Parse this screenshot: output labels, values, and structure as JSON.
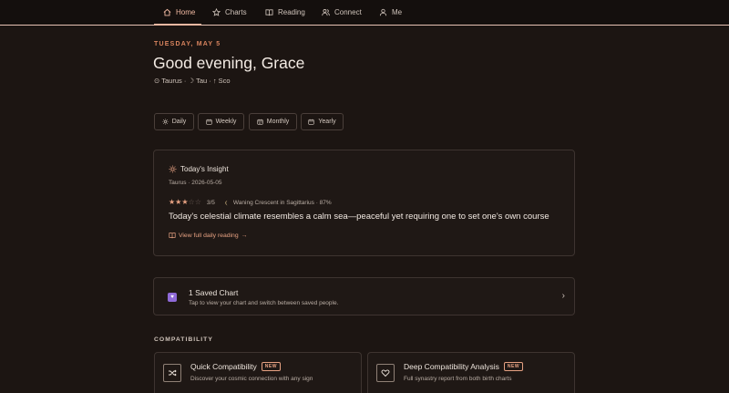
{
  "nav": {
    "items": [
      {
        "label": "Home",
        "icon": "home-icon",
        "active": true
      },
      {
        "label": "Charts",
        "icon": "star-icon",
        "active": false
      },
      {
        "label": "Reading",
        "icon": "book-icon",
        "active": false
      },
      {
        "label": "Connect",
        "icon": "users-icon",
        "active": false
      },
      {
        "label": "Me",
        "icon": "user-icon",
        "active": false
      }
    ]
  },
  "header": {
    "date": "TUESDAY, MAY 5",
    "greeting": "Good evening, Grace",
    "signs": "⊙ Taurus · ☽ Tau · ↑ Sco"
  },
  "periods": [
    {
      "label": "Daily",
      "icon": "sun-icon"
    },
    {
      "label": "Weekly",
      "icon": "calendar-icon"
    },
    {
      "label": "Monthly",
      "icon": "calendar-grid-icon"
    },
    {
      "label": "Yearly",
      "icon": "calendar-icon"
    }
  ],
  "insight": {
    "title": "Today's Insight",
    "subtitle": "Taurus · 2026-05-05",
    "rating": 3,
    "rating_max": 5,
    "rating_text": "3/5",
    "moon_text": "Waning Crescent in Sagittarius · 87%",
    "body": "Today's celestial climate resembles a calm sea—peaceful yet requiring one to set one's own course",
    "link_label": "View full daily reading",
    "link_arrow": "→"
  },
  "saved_chart": {
    "title": "1 Saved Chart",
    "subtitle": "Tap to view your chart and switch between saved people.",
    "chevron": "›"
  },
  "compatibility": {
    "section_label": "COMPATIBILITY",
    "cards": [
      {
        "title": "Quick Compatibility",
        "badge": "NEW",
        "subtitle": "Discover your cosmic connection with any sign",
        "icon": "shuffle-icon"
      },
      {
        "title": "Deep Compatibility Analysis",
        "badge": "NEW",
        "subtitle": "Full synastry report from both birth charts",
        "icon": "heart-icon"
      }
    ]
  },
  "colors": {
    "background": "#1c1512",
    "accent": "#e6a182",
    "date_accent": "#d9845e",
    "saved_icon": "#8f6ad8"
  }
}
